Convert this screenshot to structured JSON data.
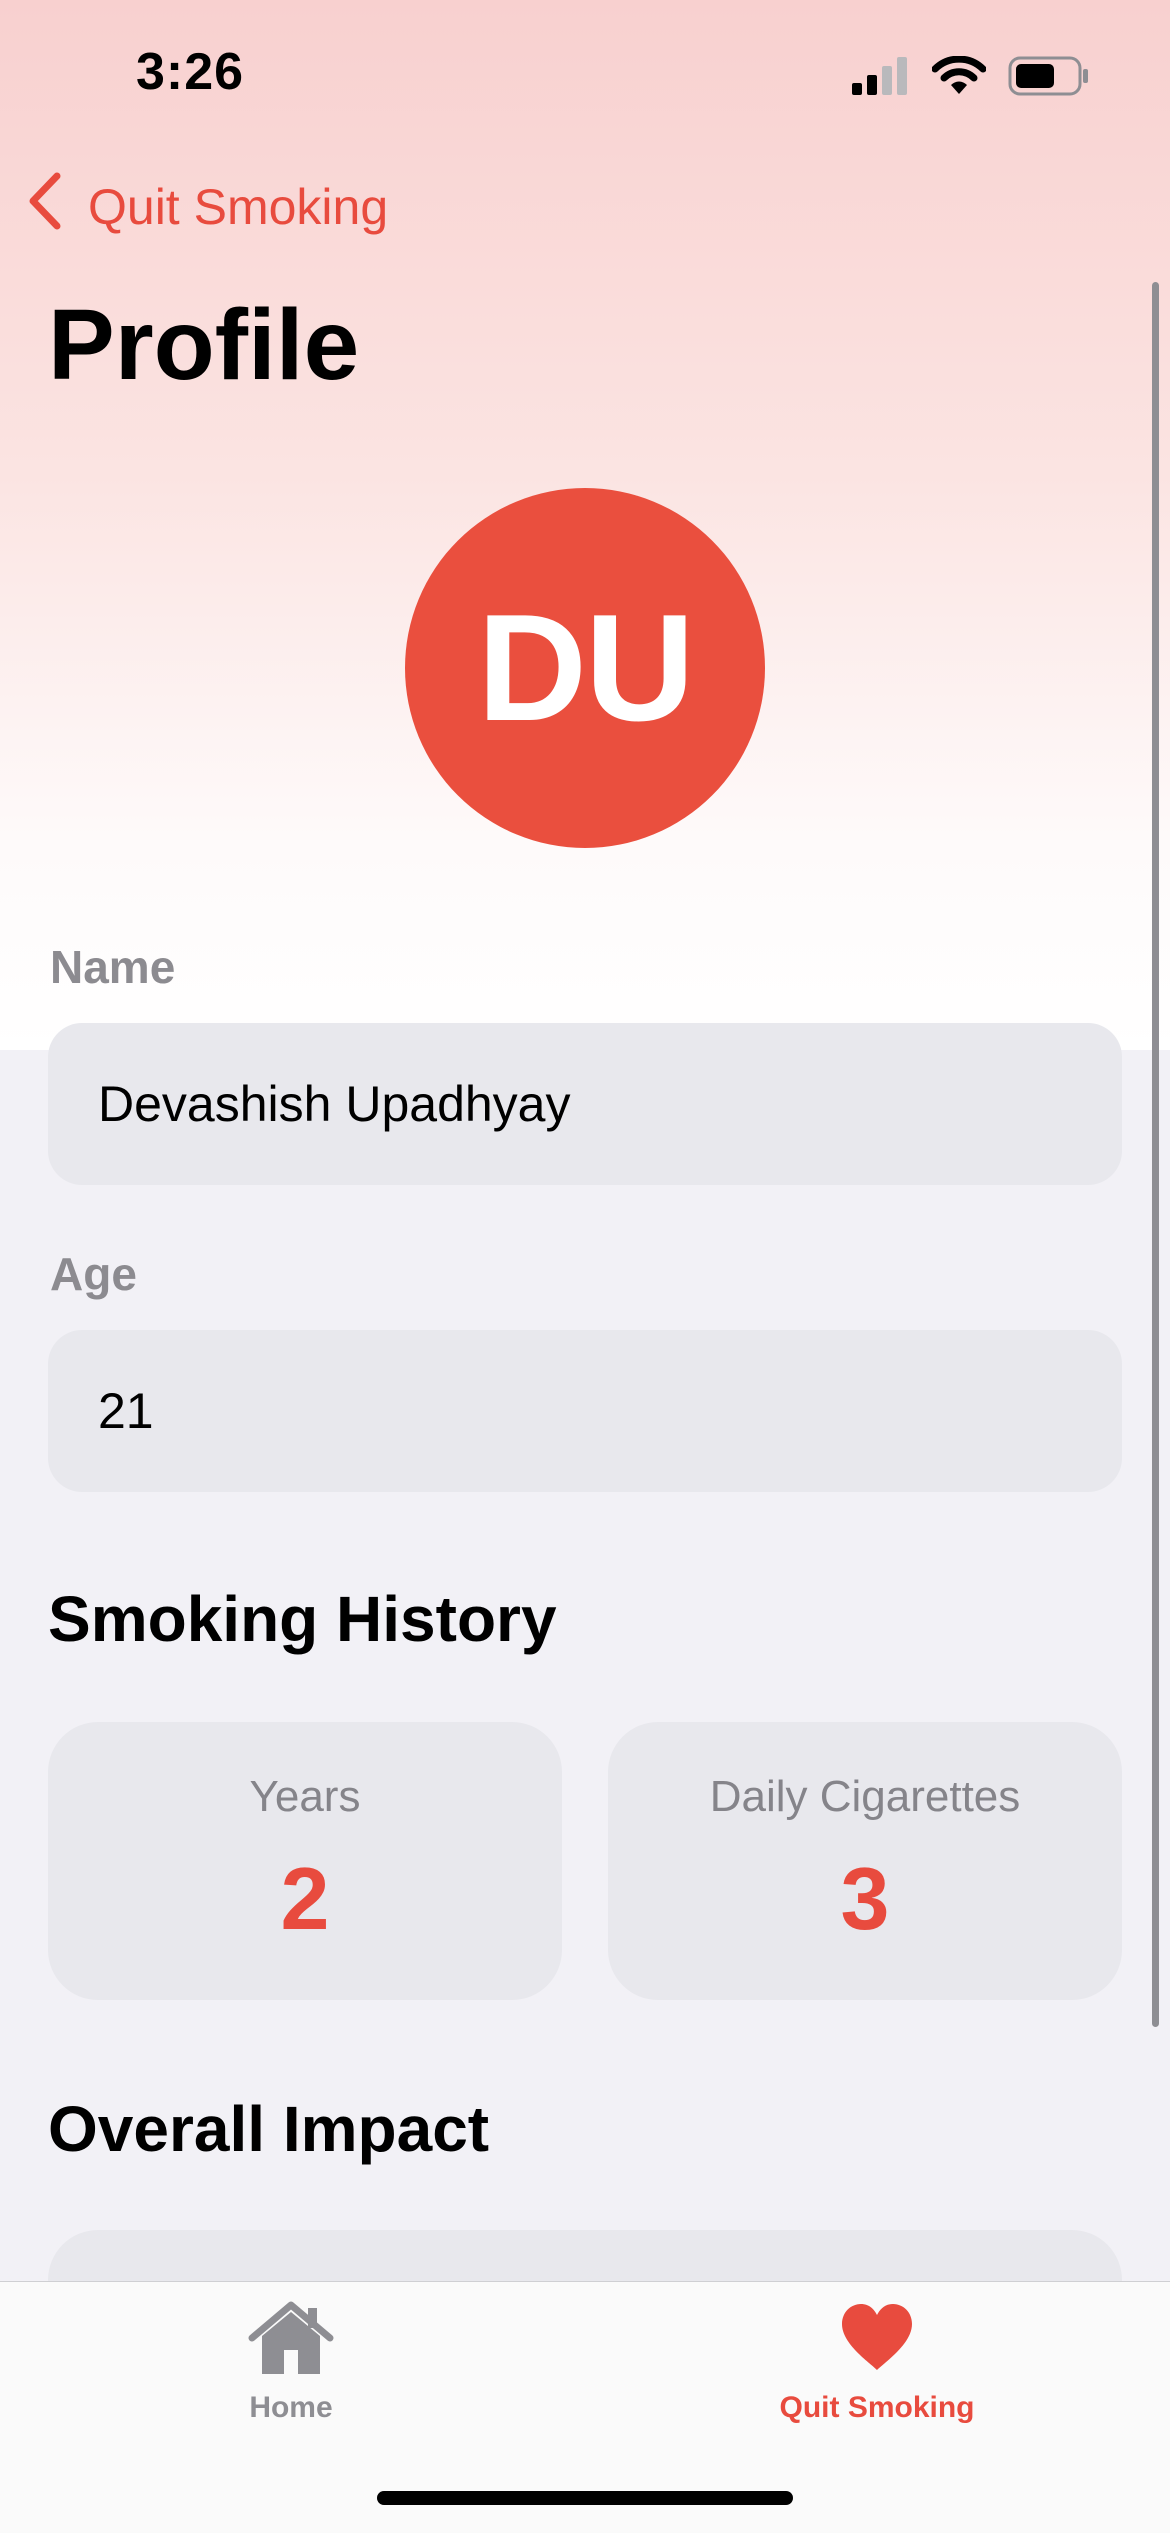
{
  "status_bar": {
    "time": "3:26",
    "icons": [
      "cellular-signal-icon",
      "wifi-icon",
      "battery-icon"
    ]
  },
  "nav": {
    "back_label": "Quit Smoking",
    "back_icon": "chevron-left-icon"
  },
  "page": {
    "title": "Profile"
  },
  "avatar": {
    "initials": "DU",
    "color": "#ea4f3e"
  },
  "fields": {
    "name": {
      "label": "Name",
      "value": "Devashish Upadhyay"
    },
    "age": {
      "label": "Age",
      "value": "21"
    }
  },
  "smoking_history": {
    "title": "Smoking History",
    "years": {
      "label": "Years",
      "value": "2"
    },
    "daily_cigarettes": {
      "label": "Daily Cigarettes",
      "value": "3"
    }
  },
  "overall_impact": {
    "title": "Overall Impact"
  },
  "tab_bar": {
    "tabs": [
      {
        "label": "Home",
        "icon": "house-icon",
        "active": false
      },
      {
        "label": "Quit Smoking",
        "icon": "heart-icon",
        "active": true
      }
    ]
  },
  "colors": {
    "accent": "#e84b3e",
    "inactive_tab": "#8e8e93",
    "card_background": "#e8e8ed",
    "page_background": "#f2f1f6"
  }
}
